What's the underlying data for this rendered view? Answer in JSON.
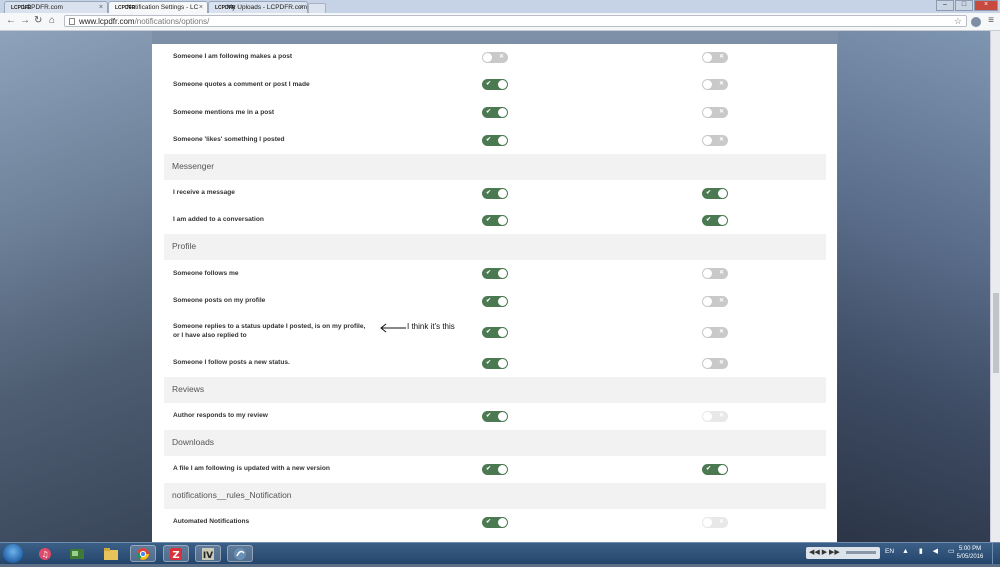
{
  "browser": {
    "tabs": [
      {
        "favicon": "LCPDFR",
        "title": "LCPDFR.com"
      },
      {
        "favicon": "LCPDFR",
        "title": "Notification Settings - LC"
      },
      {
        "favicon": "LCPDFR",
        "title": "My Uploads - LCPDFR.com"
      }
    ],
    "url_host": "www.lcpdfr.com",
    "url_path": "/notifications/options/",
    "extensions": [
      "ABP",
      "ext"
    ]
  },
  "notifications": {
    "row_following_post": {
      "label": "Someone I am following makes a post",
      "col1": "off",
      "col2": "off"
    },
    "row_quotes": {
      "label": "Someone quotes a comment or post I made",
      "col1": "on",
      "col2": "off"
    },
    "row_mentions": {
      "label": "Someone mentions me in a post",
      "col1": "on",
      "col2": "off"
    },
    "row_likes": {
      "label": "Someone 'likes' something I posted",
      "col1": "on",
      "col2": "off"
    },
    "section_messenger": "Messenger",
    "row_receive_message": {
      "label": "I receive a message",
      "col1": "on",
      "col2": "on"
    },
    "row_added_conversation": {
      "label": "I am added to a conversation",
      "col1": "on",
      "col2": "on"
    },
    "section_profile": "Profile",
    "row_follows_me": {
      "label": "Someone follows me",
      "col1": "on",
      "col2": "off"
    },
    "row_posts_profile": {
      "label": "Someone posts on my profile",
      "col1": "on",
      "col2": "off"
    },
    "row_status_reply_line1": "Someone replies to a status update I posted, is on my profile,",
    "row_status_reply_line2": "or I have also replied to",
    "row_status_reply": {
      "col1": "on",
      "col2": "off"
    },
    "row_follow_status": {
      "label": "Someone I follow posts a new status.",
      "col1": "on",
      "col2": "off"
    },
    "section_reviews": "Reviews",
    "row_author_responds": {
      "label": "Author responds to my review",
      "col1": "on",
      "col2": "disabled"
    },
    "section_downloads": "Downloads",
    "row_file_updated": {
      "label": "A file I am following is updated with a new version",
      "col1": "on",
      "col2": "on"
    },
    "section_rules": "notifications__rules_Notification",
    "row_automated": {
      "label": "Automated Notifications",
      "col1": "on",
      "col2": "disabled"
    }
  },
  "annotation": "I think it's this",
  "taskbar": {
    "pinned": [
      "windows-media",
      "itunes",
      "game",
      "explorer",
      "chrome",
      "app-z",
      "app-iv",
      "app-dolphin"
    ],
    "media_controls": "◀◀ ▶ ▶▶",
    "language": "EN",
    "time": "5:00 PM",
    "date": "5/05/2016"
  }
}
